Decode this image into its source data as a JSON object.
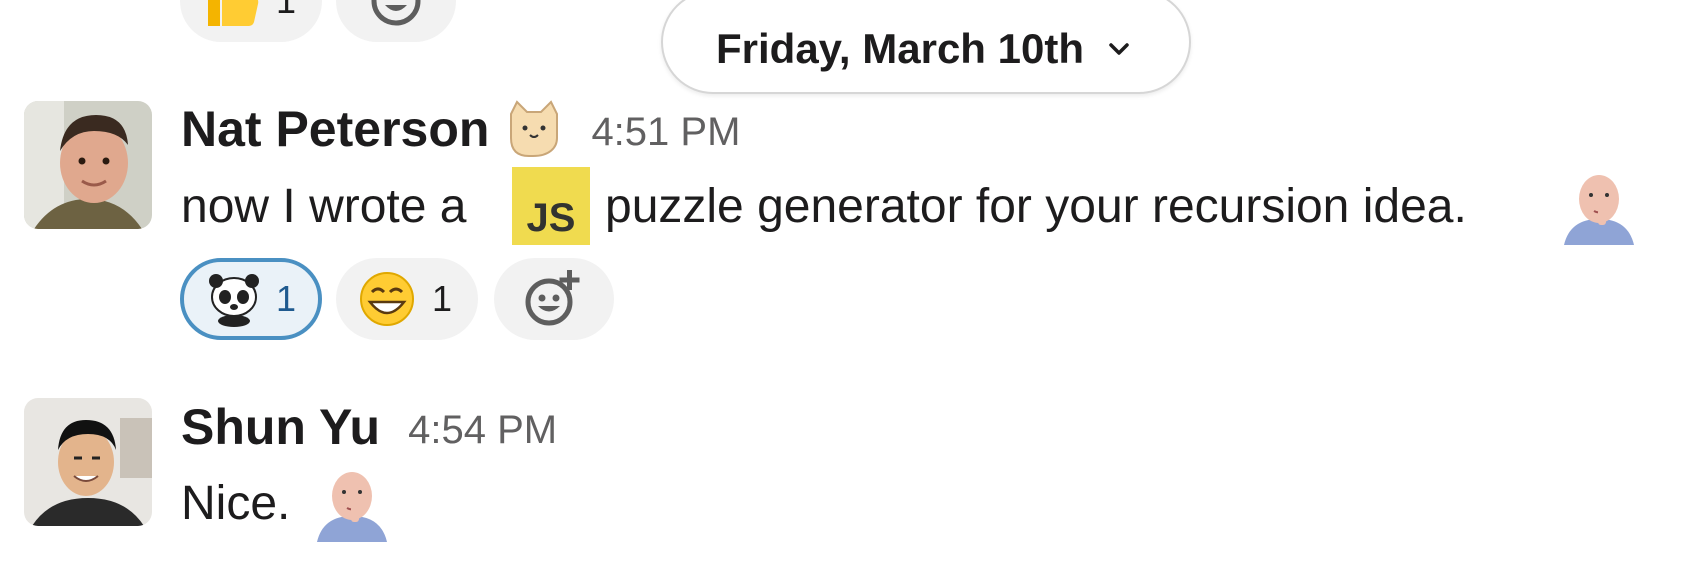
{
  "date_divider": {
    "label": "Friday, March 10th"
  },
  "top_reactions": [
    {
      "emoji": "thumbs-up",
      "count": "1"
    },
    {
      "emoji": "add-reaction",
      "count": ""
    }
  ],
  "messages": [
    {
      "author": "Nat Peterson",
      "status_emoji": "cat-emoji",
      "time": "4:51 PM",
      "text_before": "now I wrote a",
      "inline_emoji_label": "JS",
      "text_after": "puzzle generator for your recursion idea.",
      "reactions": [
        {
          "emoji": "panda",
          "count": "1",
          "selected": true
        },
        {
          "emoji": "grinning-face",
          "count": "1",
          "selected": false
        }
      ]
    },
    {
      "author": "Shun Yu",
      "time": "4:54 PM",
      "text": "Nice."
    }
  ],
  "colors": {
    "selected_border": "#4a90c2",
    "js_yellow": "#f0db4f",
    "muted": "#616061"
  }
}
